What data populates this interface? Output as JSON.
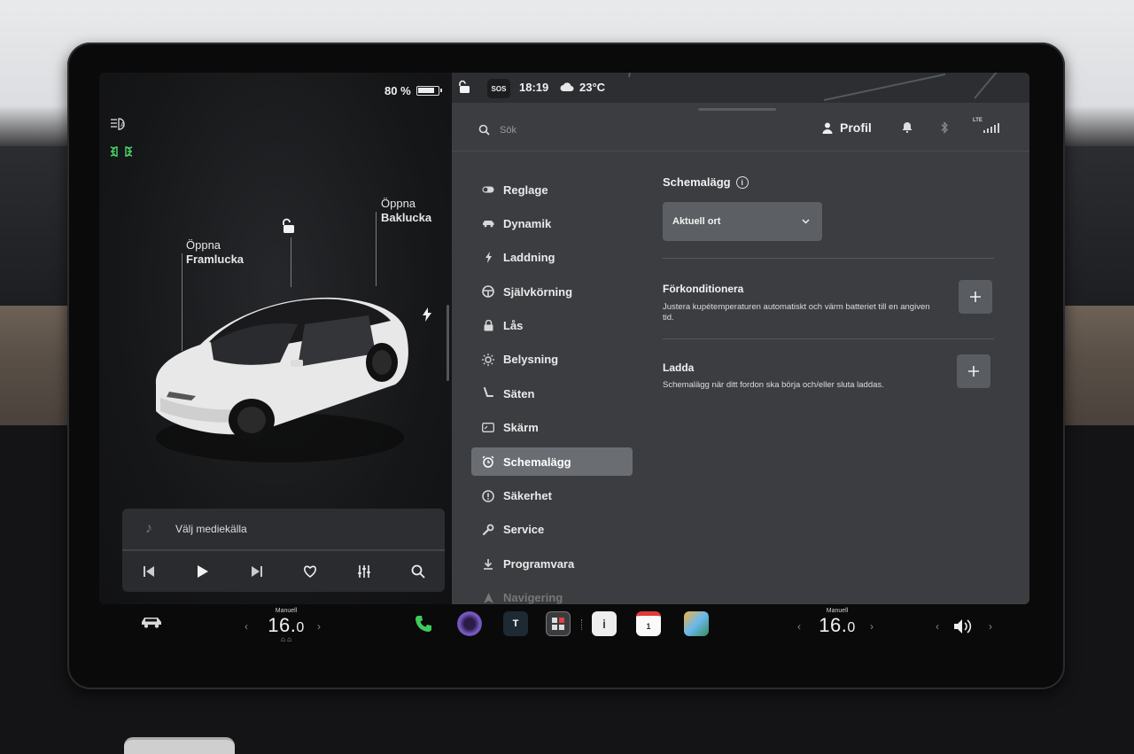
{
  "left_panel": {
    "battery_percent": "80 %",
    "labels": {
      "front_trunk_action": "Öppna",
      "front_trunk_name": "Framlucka",
      "rear_trunk_action": "Öppna",
      "rear_trunk_name": "Baklucka"
    },
    "media": {
      "source_label": "Välj mediekälla"
    }
  },
  "status_bar": {
    "sos": "SOS",
    "time": "18:19",
    "temperature": "23°C"
  },
  "top_bar": {
    "search_placeholder": "Sök",
    "profile_label": "Profil",
    "network": "LTE"
  },
  "nav": {
    "items": [
      {
        "label": "Reglage",
        "icon": "toggle-icon"
      },
      {
        "label": "Dynamik",
        "icon": "car-icon"
      },
      {
        "label": "Laddning",
        "icon": "bolt-icon"
      },
      {
        "label": "Självkörning",
        "icon": "steering-wheel-icon"
      },
      {
        "label": "Lås",
        "icon": "lock-icon"
      },
      {
        "label": "Belysning",
        "icon": "sun-icon"
      },
      {
        "label": "Säten",
        "icon": "seat-icon"
      },
      {
        "label": "Skärm",
        "icon": "display-icon"
      },
      {
        "label": "Schemalägg",
        "icon": "alarm-clock-icon"
      },
      {
        "label": "Säkerhet",
        "icon": "alert-icon"
      },
      {
        "label": "Service",
        "icon": "wrench-icon"
      },
      {
        "label": "Programvara",
        "icon": "download-icon"
      },
      {
        "label": "Navigering",
        "icon": "navigation-icon"
      }
    ],
    "active_index": 8
  },
  "content": {
    "title": "Schemalägg",
    "location_select": "Aktuell ort",
    "precondition_title": "Förkonditionera",
    "precondition_desc": "Justera kupétemperaturen automatiskt och värm batteriet till en angiven tid.",
    "charge_title": "Ladda",
    "charge_desc": "Schemalägg när ditt fordon ska börja och/eller sluta laddas."
  },
  "dock": {
    "driver_temp_mode": "Manuell",
    "driver_temp_int": "16.",
    "driver_temp_dec": "0",
    "passenger_temp_mode": "Manuell",
    "passenger_temp_int": "16.",
    "passenger_temp_dec": "0",
    "toybox_label": "T",
    "calendar_day": "1"
  },
  "colors": {
    "active_nav_bg": "#6a6d72",
    "parking_lights": "#49d06a",
    "phone": "#3fcb5a",
    "calendar_red": "#e03a3a"
  }
}
